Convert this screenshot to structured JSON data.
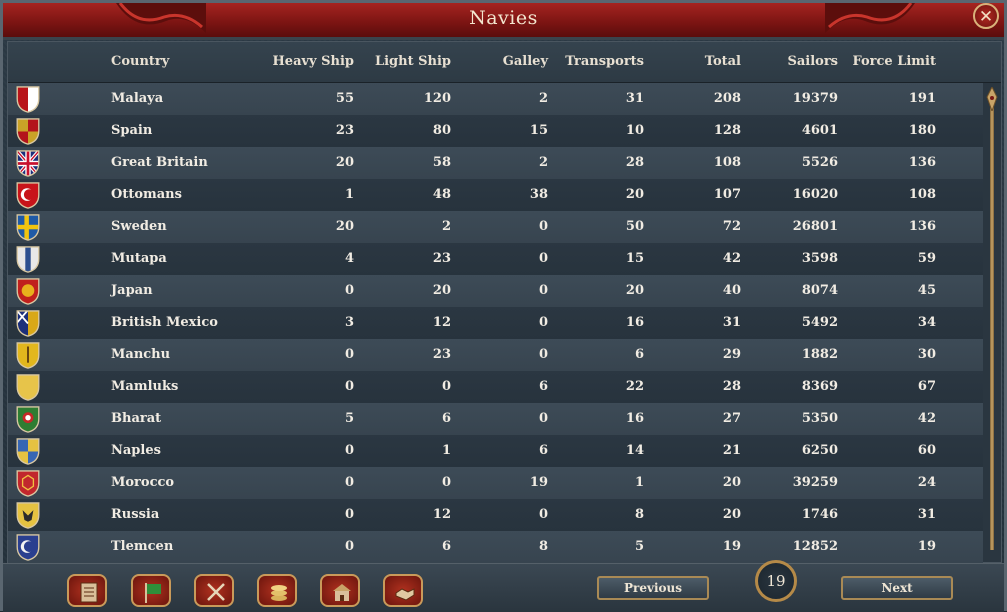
{
  "window": {
    "title": "Navies",
    "close_icon": "close-icon"
  },
  "columns": {
    "country": "Country",
    "heavy": "Heavy Ship",
    "light": "Light Ship",
    "galley": "Galley",
    "transports": "Transports",
    "total": "Total",
    "sailors": "Sailors",
    "force_limit": "Force Limit"
  },
  "rows": [
    {
      "country": "Malaya",
      "heavy": "55",
      "light": "120",
      "galley": "2",
      "transports": "31",
      "total": "208",
      "sailors": "19379",
      "force_limit": "191",
      "flag": {
        "a": "#b8141a",
        "b": "#ffffff",
        "pattern": "split"
      }
    },
    {
      "country": "Spain",
      "heavy": "23",
      "light": "80",
      "galley": "15",
      "transports": "10",
      "total": "128",
      "sailors": "4601",
      "force_limit": "180",
      "flag": {
        "a": "#c9a227",
        "b": "#b3141b",
        "pattern": "quarter"
      }
    },
    {
      "country": "Great Britain",
      "heavy": "20",
      "light": "58",
      "galley": "2",
      "transports": "28",
      "total": "108",
      "sailors": "5526",
      "force_limit": "136",
      "flag": {
        "a": "#1c2f7a",
        "b": "#c8102e",
        "pattern": "union"
      }
    },
    {
      "country": "Ottomans",
      "heavy": "1",
      "light": "48",
      "galley": "38",
      "transports": "20",
      "total": "107",
      "sailors": "16020",
      "force_limit": "108",
      "flag": {
        "a": "#c8141a",
        "b": "#ffffff",
        "pattern": "crescent"
      }
    },
    {
      "country": "Sweden",
      "heavy": "20",
      "light": "2",
      "galley": "0",
      "transports": "50",
      "total": "72",
      "sailors": "26801",
      "force_limit": "136",
      "flag": {
        "a": "#1f5aa6",
        "b": "#f1c40f",
        "pattern": "cross"
      }
    },
    {
      "country": "Mutapa",
      "heavy": "4",
      "light": "23",
      "galley": "0",
      "transports": "15",
      "total": "42",
      "sailors": "3598",
      "force_limit": "59",
      "flag": {
        "a": "#e8e8e8",
        "b": "#2c4f8f",
        "pattern": "stripe"
      }
    },
    {
      "country": "Japan",
      "heavy": "0",
      "light": "20",
      "galley": "0",
      "transports": "20",
      "total": "40",
      "sailors": "8074",
      "force_limit": "45",
      "flag": {
        "a": "#c0201d",
        "b": "#e8b01c",
        "pattern": "sun"
      }
    },
    {
      "country": "British Mexico",
      "heavy": "3",
      "light": "12",
      "galley": "0",
      "transports": "16",
      "total": "31",
      "sailors": "5492",
      "force_limit": "34",
      "flag": {
        "a": "#1c2f7a",
        "b": "#d9a818",
        "pattern": "union-half"
      }
    },
    {
      "country": "Manchu",
      "heavy": "0",
      "light": "23",
      "galley": "0",
      "transports": "6",
      "total": "29",
      "sailors": "1882",
      "force_limit": "30",
      "flag": {
        "a": "#e2b71d",
        "b": "#5a3a10",
        "pattern": "sword"
      }
    },
    {
      "country": "Mamluks",
      "heavy": "0",
      "light": "0",
      "galley": "6",
      "transports": "22",
      "total": "28",
      "sailors": "8369",
      "force_limit": "67",
      "flag": {
        "a": "#e7c44a",
        "b": "#c39b2a",
        "pattern": "plain"
      }
    },
    {
      "country": "Bharat",
      "heavy": "5",
      "light": "6",
      "galley": "0",
      "transports": "16",
      "total": "27",
      "sailors": "5350",
      "force_limit": "42",
      "flag": {
        "a": "#2e7d32",
        "b": "#c62828",
        "pattern": "bharat"
      }
    },
    {
      "country": "Naples",
      "heavy": "0",
      "light": "1",
      "galley": "6",
      "transports": "14",
      "total": "21",
      "sailors": "6250",
      "force_limit": "60",
      "flag": {
        "a": "#3766b3",
        "b": "#e5c241",
        "pattern": "quarter"
      }
    },
    {
      "country": "Morocco",
      "heavy": "0",
      "light": "0",
      "galley": "19",
      "transports": "1",
      "total": "20",
      "sailors": "39259",
      "force_limit": "24",
      "flag": {
        "a": "#c1272d",
        "b": "#9c1b20",
        "pattern": "hex"
      }
    },
    {
      "country": "Russia",
      "heavy": "0",
      "light": "12",
      "galley": "0",
      "transports": "8",
      "total": "20",
      "sailors": "1746",
      "force_limit": "31",
      "flag": {
        "a": "#e5c241",
        "b": "#2b2b2b",
        "pattern": "eagle"
      }
    },
    {
      "country": "Tlemcen",
      "heavy": "0",
      "light": "6",
      "galley": "8",
      "transports": "5",
      "total": "19",
      "sailors": "12852",
      "force_limit": "19",
      "flag": {
        "a": "#2a3f8f",
        "b": "#f2f2f2",
        "pattern": "crescent"
      }
    }
  ],
  "bottom": {
    "buttons": [
      {
        "icon": "ledger-icon"
      },
      {
        "icon": "flag-icon"
      },
      {
        "icon": "crossed-swords-icon"
      },
      {
        "icon": "coins-icon"
      },
      {
        "icon": "building-icon"
      },
      {
        "icon": "handshake-icon"
      }
    ],
    "previous_label": "Previous",
    "next_label": "Next",
    "page": "19"
  },
  "colors": {
    "title_bar": "#8a1a16",
    "accent_gold": "#c99a5a"
  }
}
